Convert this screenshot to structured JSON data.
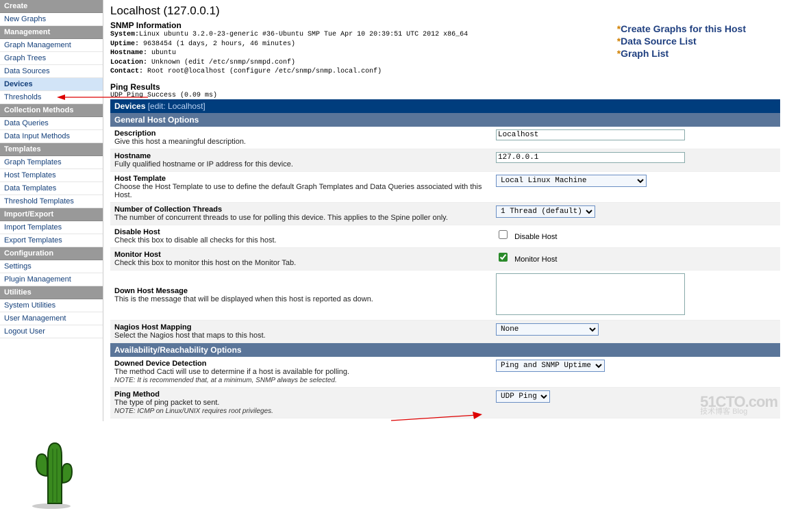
{
  "sidebar": {
    "sections": [
      {
        "title": "Create",
        "items": [
          "New Graphs"
        ]
      },
      {
        "title": "Management",
        "items": [
          "Graph Management",
          "Graph Trees",
          "Data Sources",
          "Devices",
          "Thresholds"
        ],
        "selected": "Devices"
      },
      {
        "title": "Collection Methods",
        "items": [
          "Data Queries",
          "Data Input Methods"
        ]
      },
      {
        "title": "Templates",
        "items": [
          "Graph Templates",
          "Host Templates",
          "Data Templates",
          "Threshold Templates"
        ]
      },
      {
        "title": "Import/Export",
        "items": [
          "Import Templates",
          "Export Templates"
        ]
      },
      {
        "title": "Configuration",
        "items": [
          "Settings",
          "Plugin Management"
        ]
      },
      {
        "title": "Utilities",
        "items": [
          "System Utilities",
          "User Management",
          "Logout User"
        ]
      }
    ]
  },
  "host": {
    "title": "Localhost (127.0.0.1)",
    "snmp_heading": "SNMP Information",
    "snmp_system_label": "System:",
    "snmp_system": "Linux ubuntu 3.2.0-23-generic #36-Ubuntu SMP Tue Apr 10 20:39:51 UTC 2012 x86_64",
    "snmp_uptime_label": "Uptime:",
    "snmp_uptime": " 9638454 (1 days, 2 hours, 46 minutes)",
    "snmp_hostname_label": "Hostname:",
    "snmp_hostname": " ubuntu",
    "snmp_location_label": "Location:",
    "snmp_location": " Unknown (edit /etc/snmp/snmpd.conf)",
    "snmp_contact_label": "Contact:",
    "snmp_contact": " Root root@localhost (configure /etc/snmp/snmp.local.conf)",
    "links": {
      "create": "Create Graphs for this Host",
      "ds": "Data Source List",
      "graph": "Graph List"
    },
    "ping_heading": "Ping Results",
    "ping_line": "UDP Ping Success (0.09 ms)"
  },
  "headers": {
    "devices": "Devices",
    "edit": " [edit: Localhost]",
    "general": "General Host Options",
    "avail": "Availability/Reachability Options"
  },
  "fields": {
    "description": {
      "label": "Description",
      "desc": "Give this host a meaningful description.",
      "value": "Localhost"
    },
    "hostname": {
      "label": "Hostname",
      "desc": "Fully qualified hostname or IP address for this device.",
      "value": "127.0.0.1"
    },
    "template": {
      "label": "Host Template",
      "desc": "Choose the Host Template to use to define the default Graph Templates and Data Queries associated with this Host.",
      "value": "Local Linux Machine"
    },
    "threads": {
      "label": "Number of Collection Threads",
      "desc": "The number of concurrent threads to use for polling this device. This applies to the Spine poller only.",
      "value": "1 Thread (default)"
    },
    "disable": {
      "label": "Disable Host",
      "desc": "Check this box to disable all checks for this host.",
      "cb": "Disable Host"
    },
    "monitor": {
      "label": "Monitor Host",
      "desc": "Check this box to monitor this host on the Monitor Tab.",
      "cb": "Monitor Host"
    },
    "downmsg": {
      "label": "Down Host Message",
      "desc": "This is the message that will be displayed when this host is reported as down."
    },
    "nagios": {
      "label": "Nagios Host Mapping",
      "desc": "Select the Nagios host that maps to this host.",
      "value": "None"
    },
    "detect": {
      "label": "Downed Device Detection",
      "desc": "The method Cacti will use to determine if a host is available for polling.",
      "note": "NOTE: It is recommended that, at a minimum, SNMP always be selected.",
      "value": "Ping and SNMP Uptime"
    },
    "pingmethod": {
      "label": "Ping Method",
      "desc": "The type of ping packet to sent.",
      "note": "NOTE: ICMP on Linux/UNIX requires root privileges.",
      "value": "UDP Ping"
    }
  },
  "watermark": {
    "line1": "51CTO.com",
    "line2": "技术博客    Blog"
  }
}
